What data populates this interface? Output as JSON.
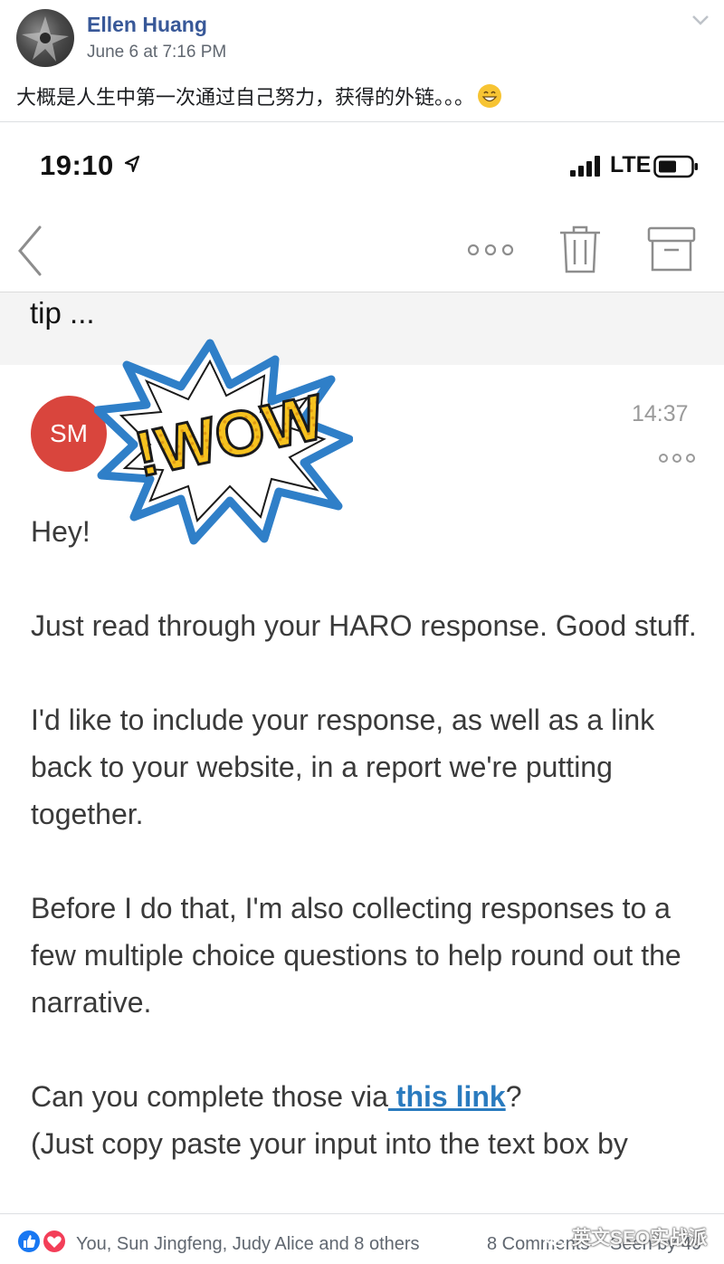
{
  "post": {
    "author": "Ellen Huang",
    "time": "June 6 at 7:16 PM",
    "text": "大概是人生中第一次通过自己努力，获得的外链。。。"
  },
  "phone": {
    "status_time": "19:10",
    "network": "LTE",
    "subject_preview": "tip ...",
    "sender_initials": "SM",
    "message_time": "14:37",
    "sticker_text": "!WOW",
    "body": {
      "greeting": "Hey!",
      "p1": "Just read through your HARO response. Good stuff.",
      "p2": "I'd like to include your response, as well as a link back to your website, in a report we're putting together.",
      "p3": "Before I do that, I'm also collecting responses to a few multiple choice questions to help round out the narrative.",
      "p4_before": "Can you complete those via",
      "p4_link": " this link",
      "p4_after": "?",
      "p5": "(Just copy paste your input into the text box by"
    }
  },
  "footer": {
    "reactors": "You, Sun Jingfeng, Judy Alice and 8 others",
    "comments": "8 Comments",
    "seen": "Seen by 49",
    "watermark": "英文SEO实战派"
  },
  "colors": {
    "author_link": "#385898",
    "sender_avatar": "#d9453d",
    "email_link": "#2a7bbf",
    "like": "#1877f2",
    "love": "#f33e58"
  },
  "icons": [
    "chevron-down-icon",
    "location-arrow-icon",
    "signal-bars-icon",
    "battery-icon",
    "back-chevron-icon",
    "more-dots-icon",
    "trash-icon",
    "archive-icon",
    "like-icon",
    "love-icon",
    "wechat-icon",
    "grin-emoji-icon"
  ]
}
